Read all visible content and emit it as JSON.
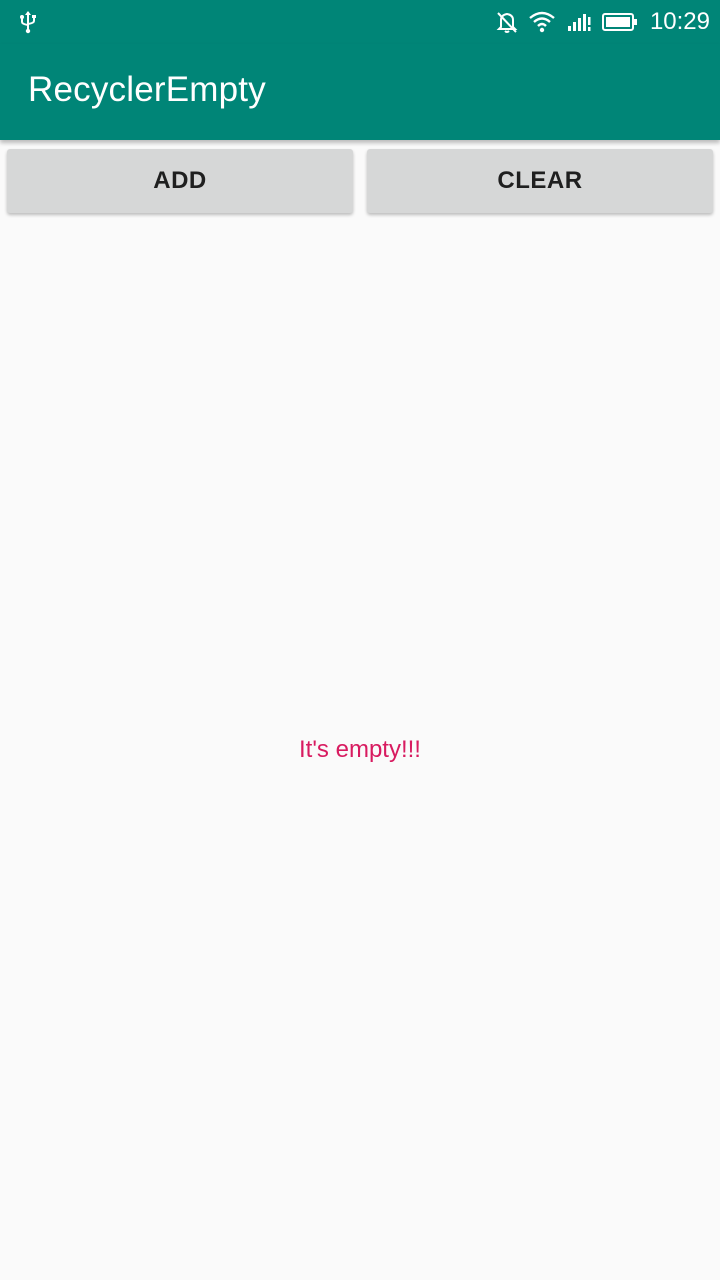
{
  "status_bar": {
    "time": "10:29",
    "icons": [
      "usb-icon",
      "mute-icon",
      "wifi-icon",
      "signal-icon",
      "battery-icon"
    ]
  },
  "app_bar": {
    "title": "RecyclerEmpty",
    "color": "#008577"
  },
  "buttons": {
    "add_label": "ADD",
    "clear_label": "CLEAR"
  },
  "main": {
    "empty_message": "It's empty!!!",
    "empty_color": "#d81b60"
  }
}
